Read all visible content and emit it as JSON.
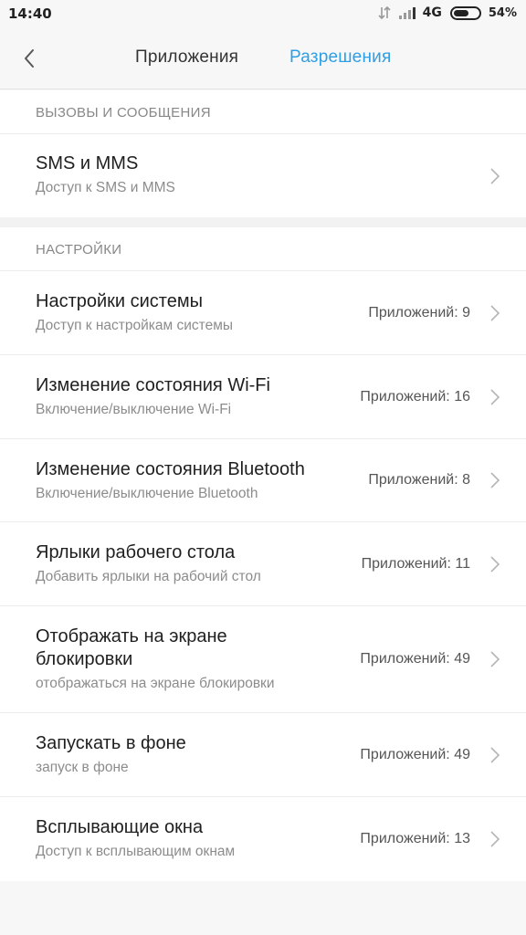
{
  "status_bar": {
    "time": "14:40",
    "network": "4G",
    "battery_percent": "54%",
    "battery_level": 0.54
  },
  "header": {
    "tab_apps": "Приложения",
    "tab_permissions": "Разрешения",
    "active_tab": "permissions",
    "accent_color": "#2d9fe6"
  },
  "sections": [
    {
      "header": "ВЫЗОВЫ И СООБЩЕНИЯ",
      "items": [
        {
          "title": "SMS и MMS",
          "desc": "Доступ к SMS и MMS",
          "count": ""
        }
      ]
    },
    {
      "header": "НАСТРОЙКИ",
      "items": [
        {
          "title": "Настройки системы",
          "desc": "Доступ к настройкам системы",
          "count": "Приложений: 9"
        },
        {
          "title": "Изменение состояния Wi-Fi",
          "desc": "Включение/выключение Wi-Fi",
          "count": "Приложений: 16"
        },
        {
          "title": "Изменение состояния Bluetooth",
          "desc": "Включение/выключение Bluetooth",
          "count": "Приложений: 8"
        },
        {
          "title": "Ярлыки рабочего стола",
          "desc": "Добавить ярлыки на рабочий стол",
          "count": "Приложений: 11"
        },
        {
          "title": "Отображать на экране блокировки",
          "desc": "отображаться на экране блокировки",
          "count": "Приложений: 49"
        },
        {
          "title": "Запускать в фоне",
          "desc": "запуск в фоне",
          "count": "Приложений: 49"
        },
        {
          "title": "Всплывающие окна",
          "desc": "Доступ к всплывающим окнам",
          "count": "Приложений: 13"
        }
      ]
    }
  ]
}
